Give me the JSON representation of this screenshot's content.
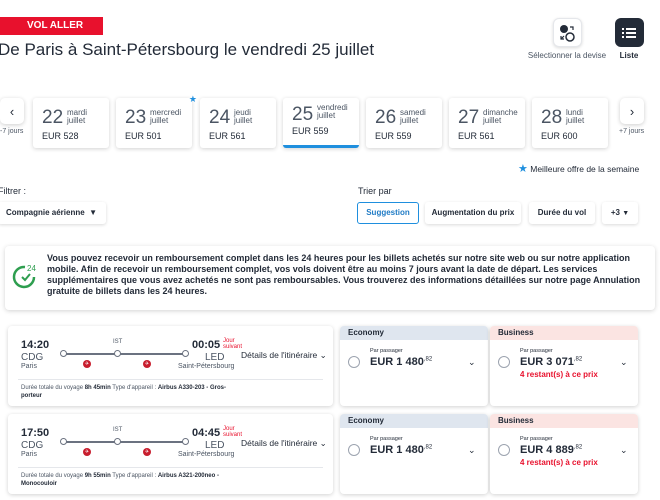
{
  "header": {
    "tag": "VOL ALLER",
    "title": "De Paris à Saint-Pétersbourg le vendredi 25 juillet"
  },
  "toolbar": {
    "currency_label": "Sélectionner la devise",
    "currency_icon": "currency-exchange-icon",
    "list_label": "Liste",
    "list_icon": "list-icon"
  },
  "date_nav": {
    "prev_label": "-7 jours",
    "next_label": "+7 jours",
    "dates": [
      {
        "day": "22",
        "weekday": "mardi",
        "month": "juillet",
        "price": "EUR 528"
      },
      {
        "day": "23",
        "weekday": "mercredi",
        "month": "juillet",
        "price": "EUR 501"
      },
      {
        "day": "24",
        "weekday": "jeudi",
        "month": "juillet",
        "price": "EUR 561"
      },
      {
        "day": "25",
        "weekday": "vendredi",
        "month": "juillet",
        "price": "EUR 559"
      },
      {
        "day": "26",
        "weekday": "samedi",
        "month": "juillet",
        "price": "EUR 559"
      },
      {
        "day": "27",
        "weekday": "dimanche",
        "month": "juillet",
        "price": "EUR 561"
      },
      {
        "day": "28",
        "weekday": "lundi",
        "month": "juillet",
        "price": "EUR 600"
      }
    ],
    "best_offer_label": "Meilleure offre de la semaine",
    "accent_color": "#1f8fde"
  },
  "filters": {
    "filter_label": "Filtrer :",
    "airline_dropdown": "Compagnie aérienne",
    "sort_label": "Trier par",
    "sort_options": [
      "Suggestion",
      "Augmentation du prix",
      "Durée du vol",
      "+3"
    ]
  },
  "notice": {
    "text": "Vous pouvez recevoir un remboursement complet dans les 24 heures pour les billets achetés sur notre site web ou sur notre application mobile. Afin de recevoir un remboursement complet, vos vols doivent être au moins 7 jours avant la date de départ. Les services supplémentaires que vous avez achetés ne sont pas remboursables. Vous trouverez des informations détaillées sur notre page Annulation gratuite de billets dans les 24 heures.",
    "icon_number": "24"
  },
  "flights": [
    {
      "dep_time": "14:20",
      "dep_code": "CDG",
      "dep_city": "Paris",
      "arr_time": "00:05",
      "next_day": "Jour suivant",
      "arr_code": "LED",
      "arr_city": "Saint-Pétersbourg",
      "via": "IST",
      "details_label": "Détails de l'itinéraire",
      "duration_label": "Durée totale du voyage",
      "duration": "8h 45min",
      "aircraft_label": "Type d'appareil :",
      "aircraft": "Airbus A330-203 - Gros-porteur",
      "economy": {
        "label": "Economy",
        "per_pax": "Par passager",
        "price": "EUR 1 480",
        "cents": ",82"
      },
      "business": {
        "label": "Business",
        "per_pax": "Par passager",
        "price": "EUR 3 071",
        "cents": ",82",
        "seats_left": "4 restant(s) à ce prix"
      }
    },
    {
      "dep_time": "17:50",
      "dep_code": "CDG",
      "dep_city": "Paris",
      "arr_time": "04:45",
      "next_day": "Jour suivant",
      "arr_code": "LED",
      "arr_city": "Saint-Pétersbourg",
      "via": "IST",
      "details_label": "Détails de l'itinéraire",
      "duration_label": "Durée totale du voyage",
      "duration": "9h 55min",
      "aircraft_label": "Type d'appareil :",
      "aircraft": "Airbus A321-200neo - Monocouloir",
      "economy": {
        "label": "Economy",
        "per_pax": "Par passager",
        "price": "EUR 1 480",
        "cents": ",82"
      },
      "business": {
        "label": "Business",
        "per_pax": "Par passager",
        "price": "EUR 4 889",
        "cents": ",82",
        "seats_left": "4 restant(s) à ce prix"
      }
    }
  ],
  "colors": {
    "brand_red": "#e8112d",
    "dark": "#232b38",
    "economy_header": "#dfe6ef",
    "business_header": "#fbe4e2"
  }
}
